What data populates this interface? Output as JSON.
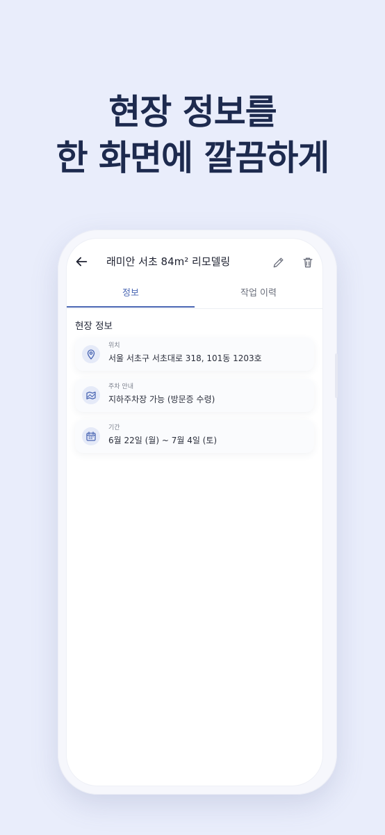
{
  "hero": {
    "line1": "현장 정보를",
    "line2": "한 화면에 깔끔하게"
  },
  "appbar": {
    "title": "래미안 서초 84m² 리모델링",
    "back_icon": "arrow-left-icon",
    "edit_icon": "pencil-icon",
    "delete_icon": "trash-icon"
  },
  "tabs": [
    {
      "label": "정보",
      "active": true
    },
    {
      "label": "작업 이력",
      "active": false
    }
  ],
  "section": {
    "title": "현장 정보"
  },
  "cards": [
    {
      "icon": "location-pin-icon",
      "label": "위치",
      "value": "서울 서초구 서초대로 318, 101동 1203호"
    },
    {
      "icon": "parking-map-icon",
      "label": "주차 안내",
      "value": "지하주차장 가능 (방문증 수령)"
    },
    {
      "icon": "calendar-icon",
      "label": "기간",
      "value": "6월 22일 (월) ~ 7월 4일 (토)"
    }
  ],
  "colors": {
    "background": "#e9edfb",
    "hero_text": "#1d2a4e",
    "accent": "#4a66b3",
    "icon_bg": "#e5eaf8"
  }
}
